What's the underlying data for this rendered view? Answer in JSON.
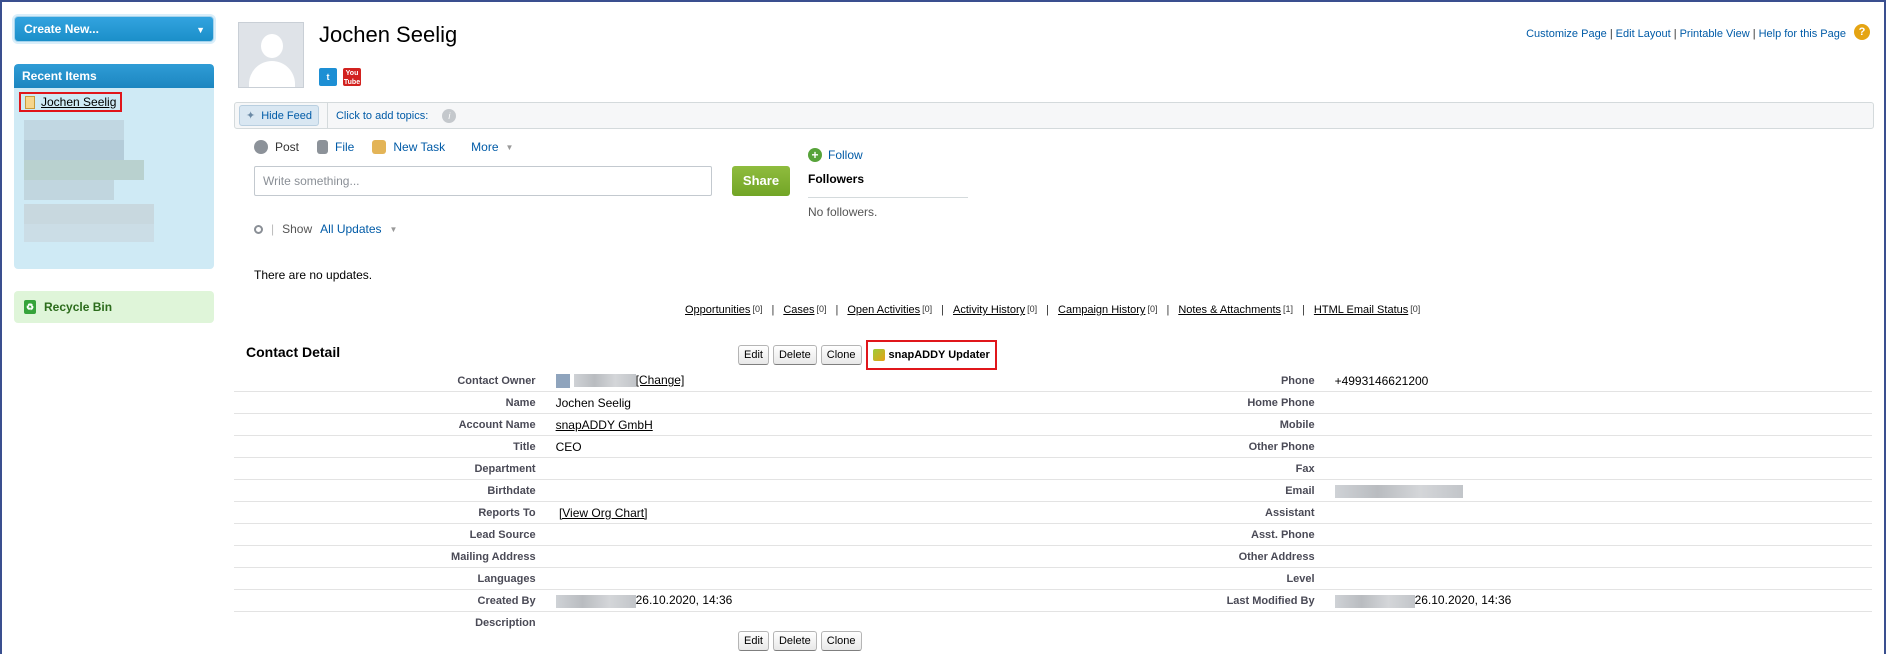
{
  "sidebar": {
    "create_label": "Create New...",
    "recent_title": "Recent Items",
    "recent_first": "Jochen Seelig",
    "recycle_label": "Recycle Bin"
  },
  "header": {
    "name": "Jochen Seelig",
    "links": [
      "Customize Page",
      "Edit Layout",
      "Printable View",
      "Help for this Page"
    ],
    "twitter_glyph": "t",
    "youtube_glyph": "You Tube",
    "help_glyph": "?"
  },
  "feedbar": {
    "hide_feed": "Hide Feed",
    "topics": "Click to add topics:",
    "info_glyph": "i"
  },
  "publisher": {
    "tabs": [
      "Post",
      "File",
      "New Task",
      "More"
    ],
    "placeholder": "Write something...",
    "share": "Share"
  },
  "follow": {
    "follow": "Follow",
    "followers": "Followers",
    "none": "No followers."
  },
  "feed": {
    "show": "Show",
    "filter": "All Updates",
    "empty": "There are no updates."
  },
  "related_lists": [
    {
      "label": "Opportunities",
      "count": "[0]"
    },
    {
      "label": "Cases",
      "count": "[0]"
    },
    {
      "label": "Open Activities",
      "count": "[0]"
    },
    {
      "label": "Activity History",
      "count": "[0]"
    },
    {
      "label": "Campaign History",
      "count": "[0]"
    },
    {
      "label": "Notes & Attachments",
      "count": "[1]"
    },
    {
      "label": "HTML Email Status",
      "count": "[0]"
    }
  ],
  "detail": {
    "title": "Contact Detail",
    "buttons": {
      "edit": "Edit",
      "delete": "Delete",
      "clone": "Clone",
      "snap": "snapADDY Updater"
    },
    "change_link": "[Change]",
    "org_chart": "[View Org Chart]",
    "rows": [
      {
        "l1": "Contact Owner",
        "v1": "",
        "l2": "Phone",
        "v2": "+4993146621200"
      },
      {
        "l1": "Name",
        "v1": "Jochen Seelig",
        "l2": "Home Phone",
        "v2": ""
      },
      {
        "l1": "Account Name",
        "v1": "snapADDY GmbH",
        "l2": "Mobile",
        "v2": ""
      },
      {
        "l1": "Title",
        "v1": "CEO",
        "l2": "Other Phone",
        "v2": ""
      },
      {
        "l1": "Department",
        "v1": "",
        "l2": "Fax",
        "v2": ""
      },
      {
        "l1": "Birthdate",
        "v1": "",
        "l2": "Email",
        "v2": ""
      },
      {
        "l1": "Reports To",
        "v1": "",
        "l2": "Assistant",
        "v2": ""
      },
      {
        "l1": "Lead Source",
        "v1": "",
        "l2": "Asst. Phone",
        "v2": ""
      },
      {
        "l1": "Mailing Address",
        "v1": "",
        "l2": "Other Address",
        "v2": ""
      },
      {
        "l1": "Languages",
        "v1": "",
        "l2": "Level",
        "v2": ""
      },
      {
        "l1": "Created By",
        "v1": "26.10.2020, 14:36",
        "l2": "Last Modified By",
        "v2": "26.10.2020, 14:36"
      },
      {
        "l1": "Description",
        "v1": "",
        "l2": "",
        "v2": ""
      }
    ]
  }
}
